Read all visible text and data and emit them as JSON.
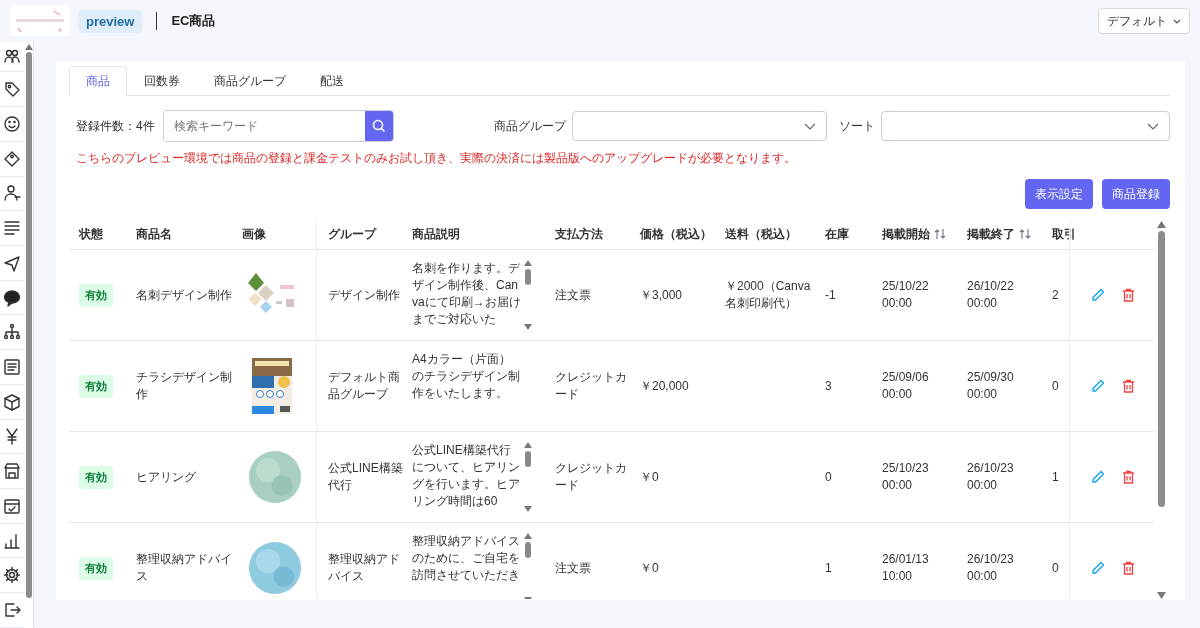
{
  "header": {
    "badge": "preview",
    "title": "EC商品",
    "view_select": "デフォルト"
  },
  "tabs": [
    {
      "label": "商品",
      "selected": true
    },
    {
      "label": "回数券",
      "selected": false
    },
    {
      "label": "商品グループ",
      "selected": false
    },
    {
      "label": "配送",
      "selected": false
    }
  ],
  "filters": {
    "count": "登録件数：4件",
    "search_placeholder": "検索キーワード",
    "group_label": "商品グループ",
    "sort_label": "ソート"
  },
  "notice": "こちらのプレビュー環境では商品の登録と課金テストのみお試し頂き、実際の決済には製品版へのアップグレードが必要となります。",
  "buttons": [
    "表示設定",
    "商品登録"
  ],
  "table": {
    "columns": [
      {
        "label": "状態",
        "sortable": false
      },
      {
        "label": "商品名",
        "sortable": false
      },
      {
        "label": "画像",
        "sortable": false
      },
      {
        "label": "グループ",
        "sortable": false
      },
      {
        "label": "商品説明",
        "sortable": false
      },
      {
        "label": "支払方法",
        "sortable": false
      },
      {
        "label": "価格（税込）",
        "sortable": false
      },
      {
        "label": "送料（税込）",
        "sortable": false
      },
      {
        "label": "在庫",
        "sortable": false
      },
      {
        "label": "掲載開始",
        "sortable": true
      },
      {
        "label": "掲載終了",
        "sortable": true
      },
      {
        "label": "取引",
        "sortable": false
      }
    ],
    "rows": [
      {
        "status": "有効",
        "name": "名刺デザイン制作",
        "group": "デザイン制作",
        "description": "名刺を作ります。デザイン制作後、Canvaにて印刷→お届けまでご対応いた",
        "payment": "注文票",
        "price": "￥3,000",
        "shipping": "￥2000（Canva名刺印刷代）",
        "stock": "-1",
        "start": "25/10/22 00:00",
        "end": "26/10/22 00:00",
        "deals": "2"
      },
      {
        "status": "有効",
        "name": "チラシデザイン制作",
        "group": "デフォルト商品グループ",
        "description": "A4カラー（片面）のチラシデザイン制作をいたします。",
        "payment": "クレジットカード",
        "price": "￥20,000",
        "shipping": "",
        "stock": "3",
        "start": "25/09/06 00:00",
        "end": "25/09/30 00:00",
        "deals": "0"
      },
      {
        "status": "有効",
        "name": "ヒアリング",
        "group": "公式LINE構築代行",
        "description": "公式LINE構築代行について、ヒアリングを行います。ヒアリング時間は60",
        "payment": "クレジットカード",
        "price": "￥0",
        "shipping": "",
        "stock": "0",
        "start": "25/10/23 00:00",
        "end": "26/10/23 00:00",
        "deals": "1"
      },
      {
        "status": "有効",
        "name": "整理収納アドバイス",
        "group": "整理収納アドバイス",
        "description": "整理収納アドバイスのために、ご自宅を訪問させていただき",
        "payment": "注文票",
        "price": "￥0",
        "shipping": "",
        "stock": "1",
        "start": "26/01/13 10:00",
        "end": "26/10/23 00:00",
        "deals": "0"
      }
    ]
  }
}
